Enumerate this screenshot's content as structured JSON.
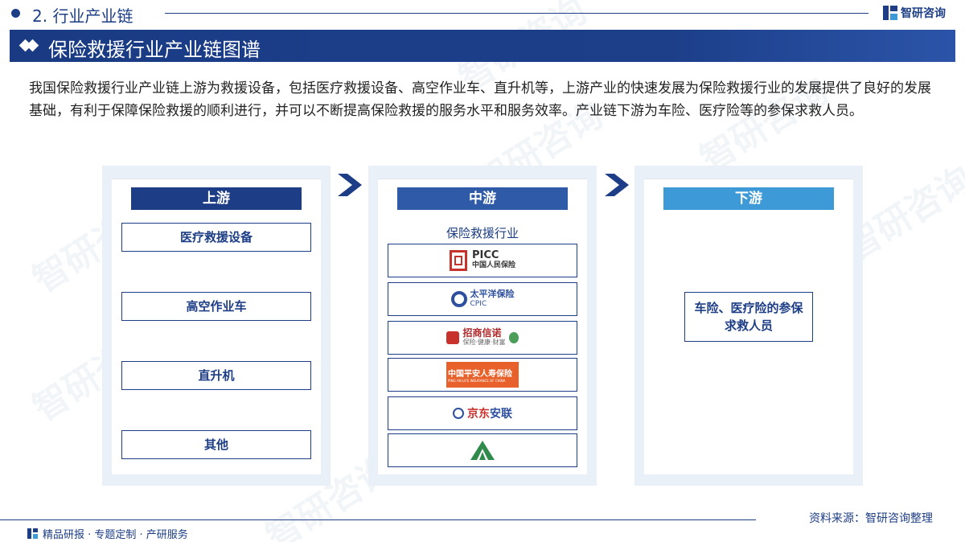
{
  "header": {
    "section_title": "2. 行业产业链",
    "logo_text": "智研咨询"
  },
  "banner": {
    "title": "保险救援行业产业链图谱"
  },
  "intro": "我国保险救援行业产业链上游为救援设备，包括医疗救援设备、高空作业车、直升机等，上游产业的快速发展为保险救援行业的发展提供了良好的发展基础，有利于保障保险救援的顺利进行，并可以不断提高保险救援的服务水平和服务效率。产业链下游为车险、医疗险等的参保求救人员。",
  "upstream": {
    "label": "上游",
    "items": [
      "医疗救援设备",
      "高空作业车",
      "直升机",
      "其他"
    ]
  },
  "midstream": {
    "label": "中游",
    "subtitle": "保险救援行业",
    "companies": [
      {
        "name": "PICC",
        "sub": "中国人民保险"
      },
      {
        "name": "太平洋保险",
        "sub": "CPIC"
      },
      {
        "name": "招商信诺",
        "sub": "保险·健康·财富"
      },
      {
        "name": "中国平安人寿保险",
        "sub": "PING AN LIFE INSURANCE OF CHINA"
      },
      {
        "name": "京东安联",
        "sub": ""
      },
      {
        "name": "",
        "sub": ""
      }
    ]
  },
  "downstream": {
    "label": "下游",
    "item": "车险、医疗险的参保求救人员"
  },
  "footer": {
    "source": "资料来源：智研咨询整理",
    "tagline": "精品研报 · 专题定制 · 产研服务"
  },
  "colors": {
    "primary": "#1d3e86",
    "mid": "#2e5aa8",
    "light": "#3d9ad6",
    "panel": "#eaf0f8"
  }
}
